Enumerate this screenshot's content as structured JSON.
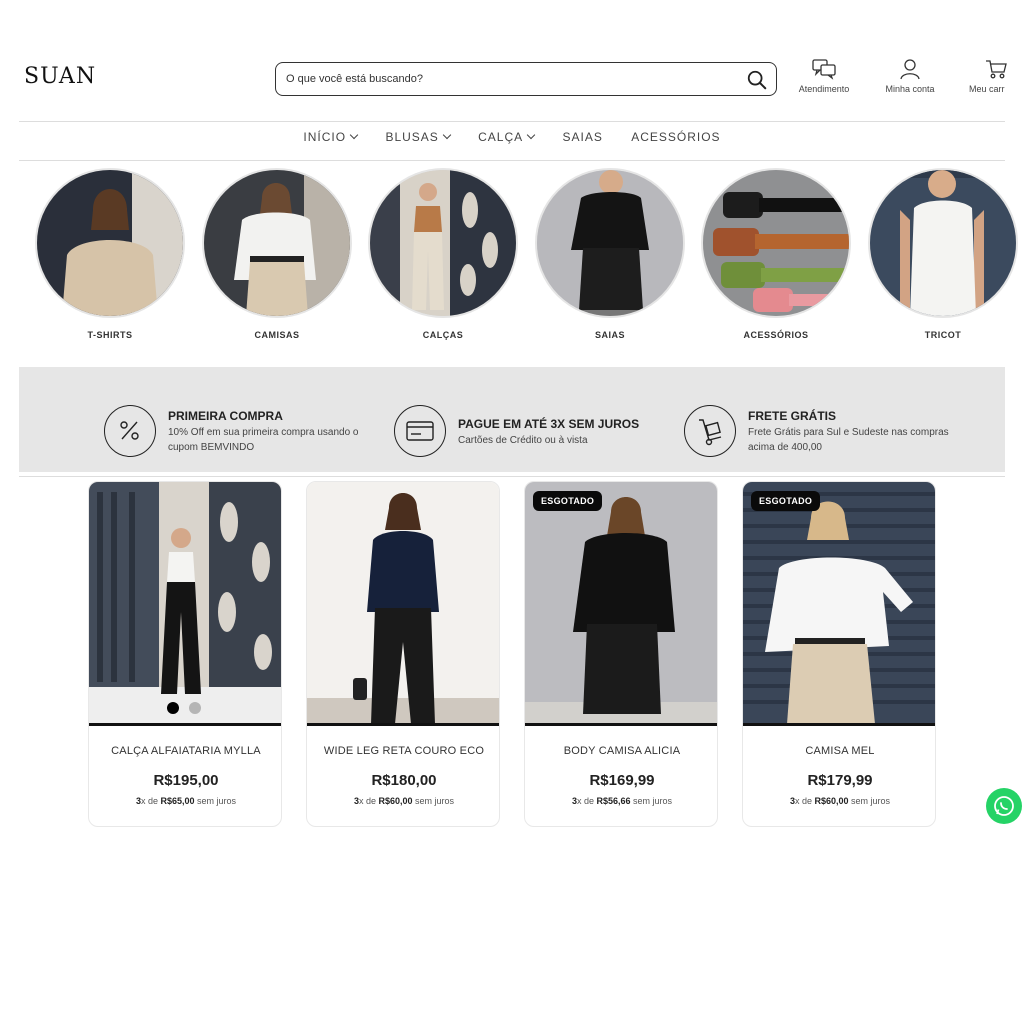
{
  "header": {
    "logo": "SUAN",
    "search_placeholder": "O que você está buscando?",
    "support_label": "Atendimento",
    "account_label": "Minha conta",
    "cart_label": "Meu carr"
  },
  "nav": {
    "items": [
      "INÍCIO",
      "BLUSAS",
      "CALÇA",
      "SAIAS",
      "ACESSÓRIOS"
    ]
  },
  "categories": [
    "T-SHIRTS",
    "CAMISAS",
    "CALÇAS",
    "SAIAS",
    "ACESSÓRIOS",
    "TRICOT"
  ],
  "info": [
    {
      "title": "PRIMEIRA COMPRA",
      "desc": "10% Off em sua primeira compra usando o cupom BEMVINDO",
      "icon": "percent-icon"
    },
    {
      "title": "PAGUE EM ATÉ 3X SEM JUROS",
      "desc": "Cartões de Crédito ou à vista",
      "icon": "credit-card-icon"
    },
    {
      "title": "FRETE GRÁTIS",
      "desc": "Frete Grátis para Sul e Sudeste nas compras acima de 400,00",
      "icon": "hand-truck-icon"
    }
  ],
  "products": [
    {
      "name": "CALÇA ALFAIATARIA MYLLA",
      "price": "R$195,00",
      "inst_count": "3",
      "inst_x": "x de ",
      "inst_value": "R$65,00",
      "inst_suffix": " sem juros",
      "badge": ""
    },
    {
      "name": "WIDE LEG RETA COURO ECO",
      "price": "R$180,00",
      "inst_count": "3",
      "inst_x": "x de ",
      "inst_value": "R$60,00",
      "inst_suffix": " sem juros",
      "badge": ""
    },
    {
      "name": "BODY CAMISA ALICIA",
      "price": "R$169,99",
      "inst_count": "3",
      "inst_x": "x de ",
      "inst_value": "R$56,66",
      "inst_suffix": " sem juros",
      "badge": "ESGOTADO"
    },
    {
      "name": "CAMISA MEL",
      "price": "R$179,99",
      "inst_count": "3",
      "inst_x": "x de ",
      "inst_value": "R$60,00",
      "inst_suffix": " sem juros",
      "badge": "ESGOTADO"
    }
  ],
  "colors": {
    "band": "#e6e6e6",
    "accent": "#111111",
    "whatsapp": "#25d366",
    "swatch_1": "#000000",
    "swatch_2": "#b5b5b5"
  }
}
